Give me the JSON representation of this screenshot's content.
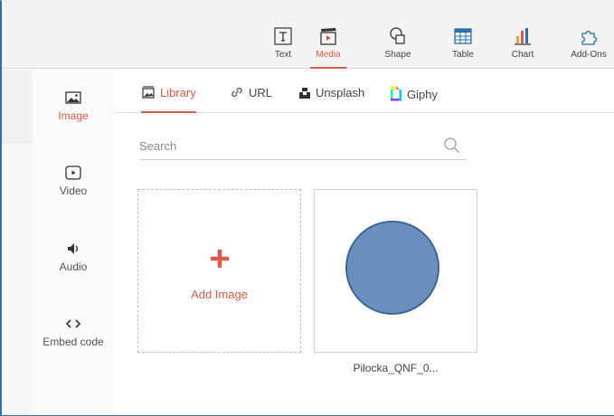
{
  "toolbar": {
    "items": [
      {
        "label": "Text",
        "icon": "text-box-icon"
      },
      {
        "label": "Media",
        "icon": "clapperboard-icon",
        "active": true
      },
      {
        "label": "Shape",
        "icon": "shape-icon"
      },
      {
        "label": "Table",
        "icon": "table-icon"
      },
      {
        "label": "Chart",
        "icon": "bar-chart-icon"
      },
      {
        "label": "Add-Ons",
        "icon": "puzzle-icon"
      }
    ]
  },
  "sidebar": {
    "items": [
      {
        "label": "Image",
        "icon": "image-icon",
        "active": true
      },
      {
        "label": "Video",
        "icon": "video-play-icon"
      },
      {
        "label": "Audio",
        "icon": "speaker-icon"
      },
      {
        "label": "Embed code",
        "icon": "code-brackets-icon"
      }
    ]
  },
  "source_tabs": [
    {
      "label": "Library",
      "icon": "library-icon",
      "active": true
    },
    {
      "label": "URL",
      "icon": "link-icon"
    },
    {
      "label": "Unsplash",
      "icon": "unsplash-icon"
    },
    {
      "label": "Giphy",
      "icon": "giphy-icon"
    }
  ],
  "search": {
    "placeholder": "Search",
    "value": ""
  },
  "library": {
    "add_label": "Add Image",
    "items": [
      {
        "caption": "Pilocka_QNF_0..."
      }
    ]
  },
  "colors": {
    "accent": "#e05a47",
    "window_border": "#2d6fb3",
    "image_fill": "#6a8fbd"
  }
}
